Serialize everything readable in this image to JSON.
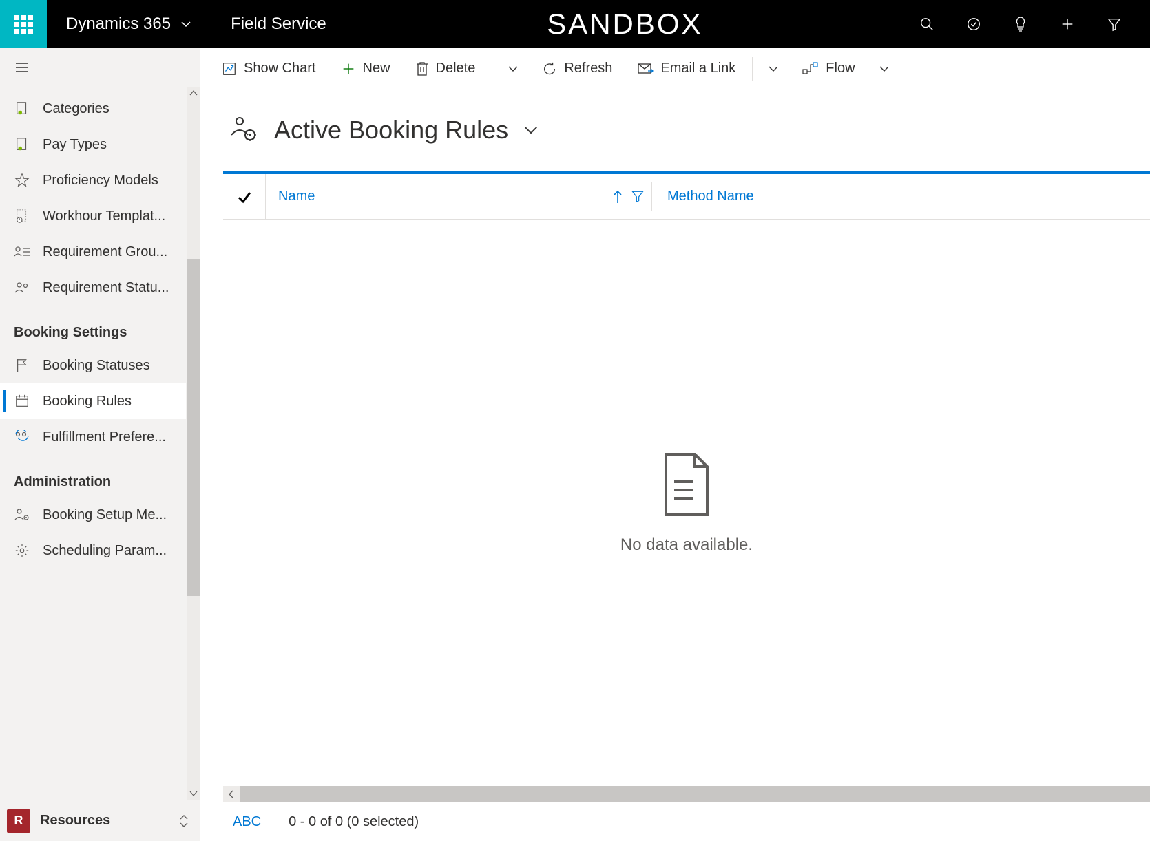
{
  "topbar": {
    "brand": "Dynamics 365",
    "module": "Field Service",
    "env": "SANDBOX"
  },
  "commands": {
    "showChart": "Show Chart",
    "new": "New",
    "delete": "Delete",
    "refresh": "Refresh",
    "emailLink": "Email a Link",
    "flow": "Flow"
  },
  "view": {
    "title": "Active Booking Rules"
  },
  "columns": {
    "name": "Name",
    "method": "Method Name"
  },
  "empty": "No data available.",
  "footer": {
    "abc": "ABC",
    "pager": "0 - 0 of 0 (0 selected)"
  },
  "sidebar": {
    "items1": [
      {
        "label": "Categories"
      },
      {
        "label": "Pay Types"
      },
      {
        "label": "Proficiency Models"
      },
      {
        "label": "Workhour Templat..."
      },
      {
        "label": "Requirement Grou..."
      },
      {
        "label": "Requirement Statu..."
      }
    ],
    "group2": "Booking Settings",
    "items2": [
      {
        "label": "Booking Statuses"
      },
      {
        "label": "Booking Rules"
      },
      {
        "label": "Fulfillment Prefere..."
      }
    ],
    "group3": "Administration",
    "items3": [
      {
        "label": "Booking Setup Me..."
      },
      {
        "label": "Scheduling Param..."
      }
    ],
    "areaBadge": "R",
    "areaLabel": "Resources"
  }
}
